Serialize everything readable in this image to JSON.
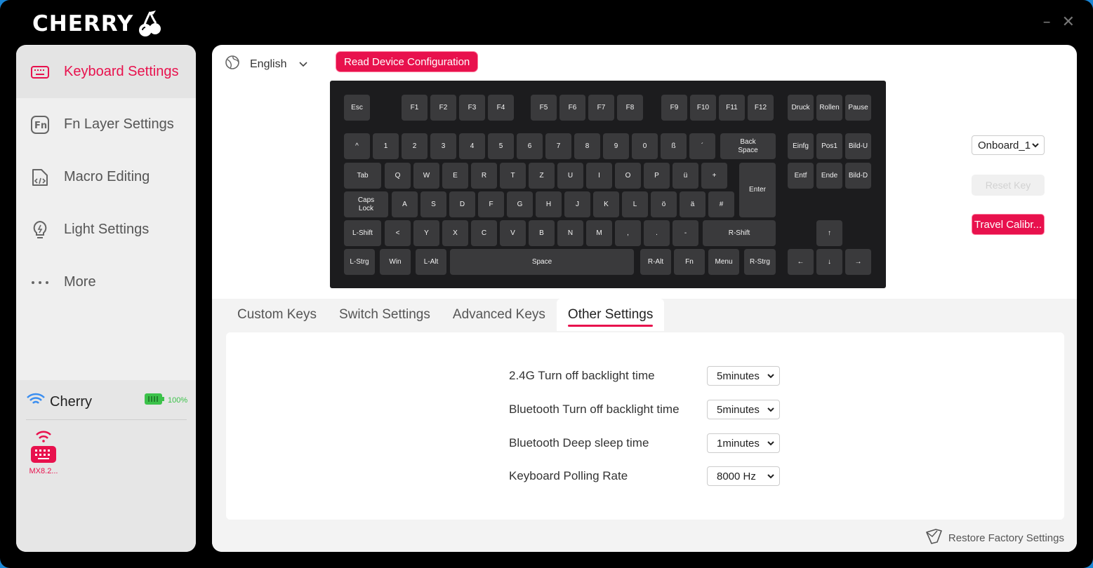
{
  "app": {
    "brand": "CHERRY",
    "minimize": "–",
    "close": "✕"
  },
  "sidebar": {
    "items": [
      {
        "label": "Keyboard Settings",
        "icon": "keyboard-icon",
        "active": true
      },
      {
        "label": "Fn Layer Settings",
        "icon": "fn-icon"
      },
      {
        "label": "Macro Editing",
        "icon": "macro-file-icon"
      },
      {
        "label": "Light Settings",
        "icon": "lightbulb-icon"
      },
      {
        "label": "More",
        "icon": "more-dots-icon"
      }
    ],
    "device": {
      "name": "Cherry",
      "battery": "100%",
      "thumb_label": "MX8.2..."
    }
  },
  "toolbar": {
    "language": "English",
    "read_button": "Read Device Configuration"
  },
  "keyboard": {
    "keys": [
      "Esc",
      "F1",
      "F2",
      "F3",
      "F4",
      "F5",
      "F6",
      "F7",
      "F8",
      "F9",
      "F10",
      "F11",
      "F12",
      "Druck",
      "Rollen",
      "Pause",
      "^",
      "1",
      "2",
      "3",
      "4",
      "5",
      "6",
      "7",
      "8",
      "9",
      "0",
      "ß",
      "´",
      "Back\nSpace",
      "Einfg",
      "Pos1",
      "Bild-U",
      "Tab",
      "Q",
      "W",
      "E",
      "R",
      "T",
      "Z",
      "U",
      "I",
      "O",
      "P",
      "ü",
      "+",
      "Enter",
      "Entf",
      "Ende",
      "Bild-D",
      "Caps\nLock",
      "A",
      "S",
      "D",
      "F",
      "G",
      "H",
      "J",
      "K",
      "L",
      "ö",
      "ä",
      "#",
      "L-Shift",
      "<",
      "Y",
      "X",
      "C",
      "V",
      "B",
      "N",
      "M",
      ",",
      ".",
      "-",
      "R-Shift",
      "↑",
      "L-Strg",
      "Win",
      "L-Alt",
      "Space",
      "R-Alt",
      "Fn",
      "Menu",
      "R-Strg",
      "←",
      "↓",
      "→"
    ]
  },
  "side": {
    "profile": "Onboard_1",
    "reset_key": "Reset Key",
    "travel": "Travel Calibr..."
  },
  "tabs": [
    "Custom Keys",
    "Switch Settings",
    "Advanced Keys",
    "Other Settings"
  ],
  "other_settings": {
    "rows": [
      {
        "label": "2.4G Turn off backlight time",
        "value": "5minutes"
      },
      {
        "label": "Bluetooth Turn off backlight time",
        "value": "5minutes"
      },
      {
        "label": "Bluetooth Deep sleep time",
        "value": "1minutes"
      },
      {
        "label": "Keyboard Polling Rate",
        "value": "8000 Hz"
      }
    ]
  },
  "footer": {
    "restore": "Restore Factory Settings"
  },
  "colors": {
    "accent": "#e8114d",
    "key": "#3a3a3c",
    "board": "#1c1c1e"
  }
}
